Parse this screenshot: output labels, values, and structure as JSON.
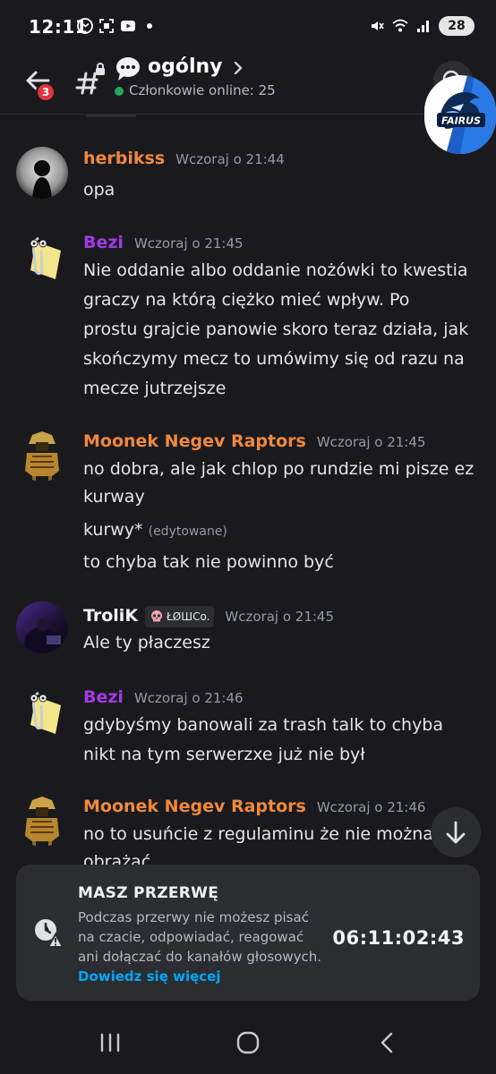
{
  "status_bar": {
    "time": "12:11",
    "battery": "28"
  },
  "header": {
    "back_badge": "3",
    "channel_name": "ogólny",
    "online_label": "Członkowie online: 25",
    "server_logo_text": "FAIRUS"
  },
  "colors": {
    "background": "#1a1a1e",
    "author_orange": "#f0883e",
    "author_purple": "#a43be6",
    "author_white": "#f2f3f5",
    "online_green": "#23a55a",
    "link_blue": "#00a8fc",
    "badge_red": "#e0343f"
  },
  "messages": [
    {
      "author": "herbikss",
      "timestamp": "Wczoraj o 21:44",
      "lines": [
        "opa"
      ]
    },
    {
      "author": "Bezi",
      "timestamp": "Wczoraj o 21:45",
      "lines": [
        "Nie oddanie albo oddanie nożówki to kwestia",
        "graczy na którą ciężko mieć wpływ. Po",
        "prostu grajcie panowie skoro teraz działa, jak",
        "skończymy mecz to umówimy się od razu na",
        "mecze jutrzejsze"
      ]
    },
    {
      "author": "Moonek Negev Raptors",
      "timestamp": "Wczoraj o 21:45",
      "lines": [
        "no dobra, ale jak chlop po rundzie mi pisze ez",
        "kurway"
      ],
      "followups": [
        {
          "text": "kurwy*",
          "edited": "(edytowane)"
        },
        {
          "text": "to chyba tak nie powinno być"
        }
      ]
    },
    {
      "author": "TroliK",
      "role_tag": "ŁØШCo.",
      "timestamp": "Wczoraj o 21:45",
      "lines": [
        "Ale ty płaczesz"
      ]
    },
    {
      "author": "Bezi",
      "timestamp": "Wczoraj o 21:46",
      "lines": [
        "gdybyśmy banowali za trash talk to chyba",
        "nikt na tym serwerzxe już nie był"
      ]
    },
    {
      "author": "Moonek Negev Raptors",
      "timestamp": "Wczoraj o 21:46",
      "lines": [
        "no to usuńcie z regulaminu że nie można",
        "obrażać"
      ]
    }
  ],
  "break_banner": {
    "title": "MASZ PRZERWĘ",
    "description_lines": [
      "Podczas przerwy nie możesz pisać",
      "na czacie, odpowiadać, reagować",
      "ani dołączać do kanałów głosowych."
    ],
    "link": "Dowiedz się więcej",
    "timer": "06:11:02:43"
  },
  "icons": {
    "back": "arrow-left-icon",
    "channel": "locked-hash-icon",
    "channel_emoji": "speech-bubble-icon",
    "search": "search-icon",
    "scroll": "arrow-down-icon",
    "break": "clock-warning-icon",
    "nav": [
      "recent-apps-icon",
      "home-icon",
      "back-icon"
    ]
  }
}
